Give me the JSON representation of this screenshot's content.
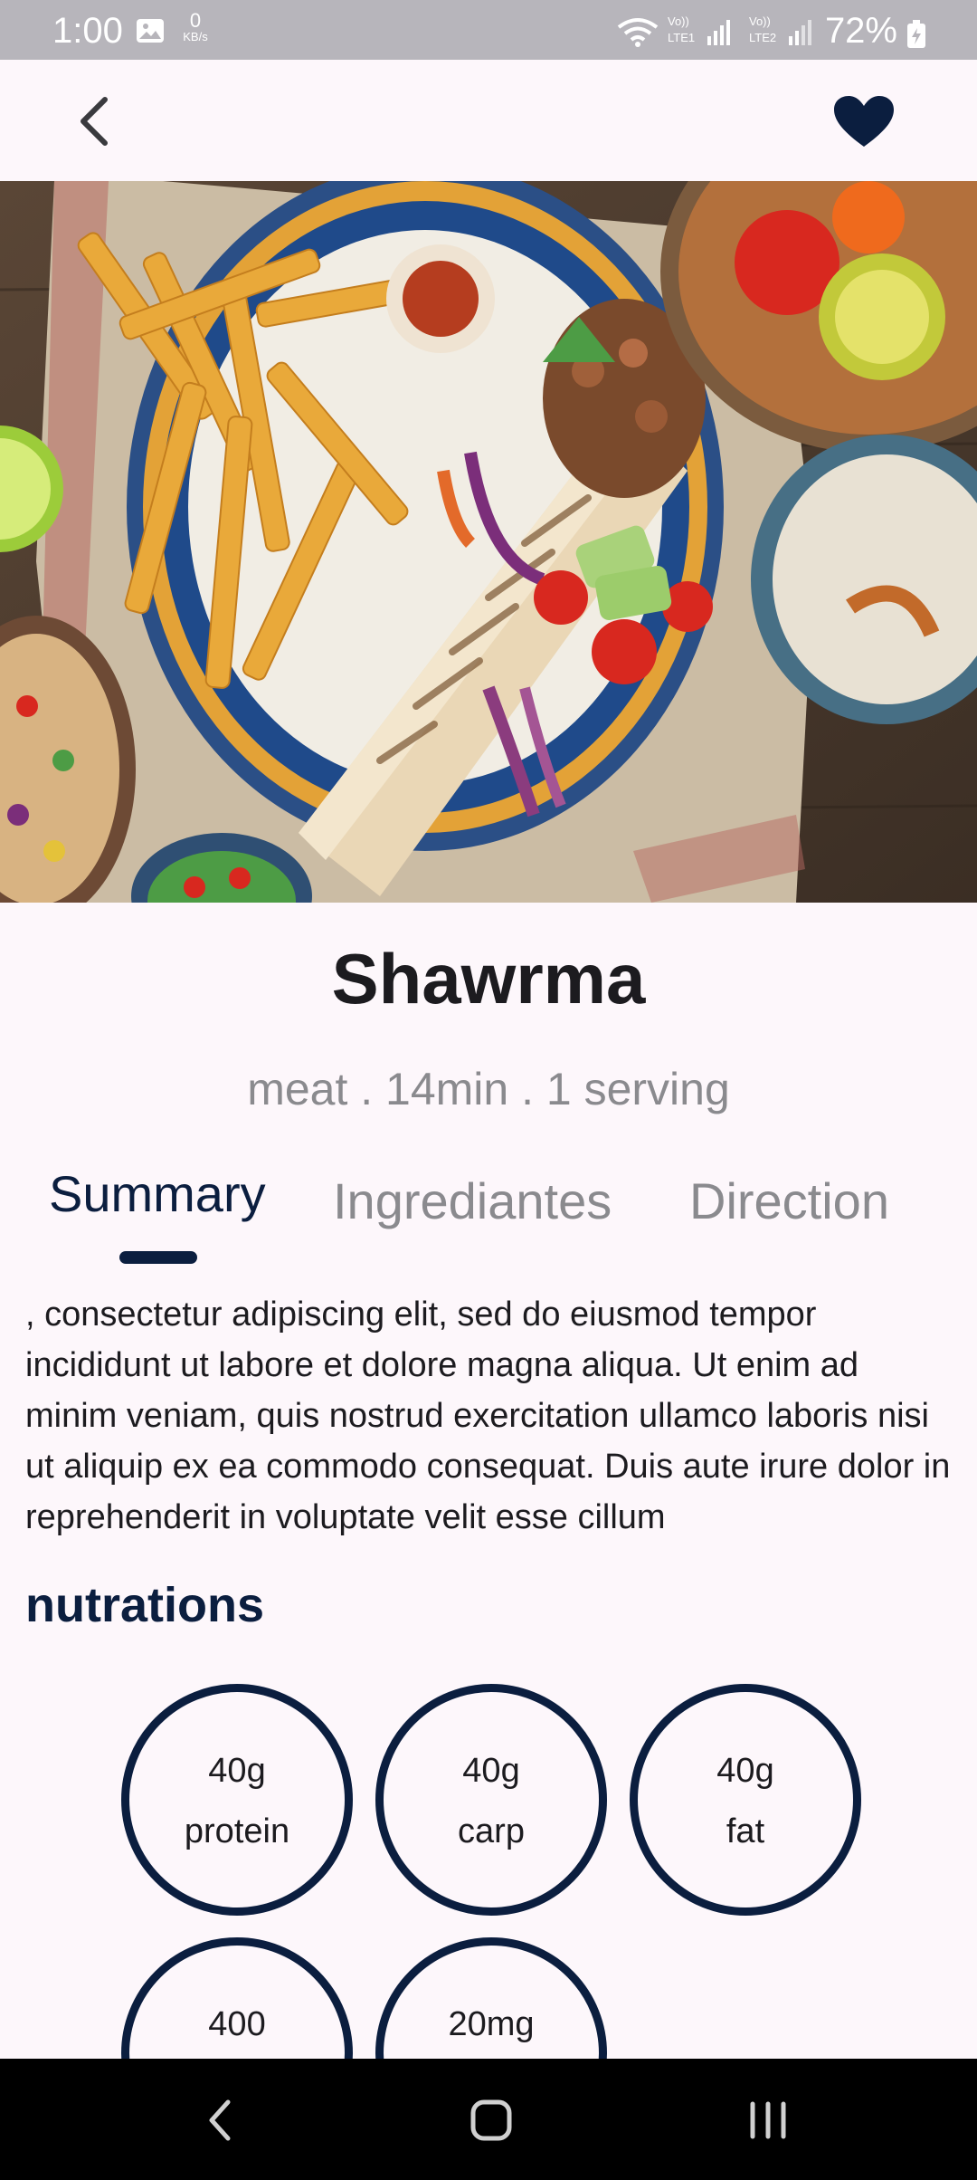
{
  "status_bar": {
    "time": "1:00",
    "net_speed_value": "0",
    "net_speed_unit": "KB/s",
    "battery": "72%",
    "icons": [
      "image-icon",
      "wifi-icon",
      "volte-lte1-signal-icon",
      "volte-lte2-signal-icon",
      "battery-charging-icon"
    ]
  },
  "app_bar": {
    "back_icon": "chevron-left-icon",
    "favorite_icon": "heart-filled-icon"
  },
  "recipe": {
    "title": "Shawrma",
    "meta": "meat . 14min . 1 serving"
  },
  "tabs": [
    {
      "label": "Summary",
      "active": true
    },
    {
      "label": "Ingrediantes",
      "active": false
    },
    {
      "label": "Direction",
      "active": false
    }
  ],
  "summary": {
    "text": ", consectetur adipiscing elit, sed do eiusmod tempor incididunt ut labore et dolore magna aliqua. Ut enim ad minim veniam, quis nostrud exercitation ullamco laboris nisi ut aliquip ex ea commodo consequat. Duis aute irure dolor in reprehenderit in voluptate velit esse cillum"
  },
  "nutrition": {
    "heading": "nutrations",
    "items": [
      {
        "amount": "40g",
        "label": "protein"
      },
      {
        "amount": "40g",
        "label": "carp"
      },
      {
        "amount": "40g",
        "label": "fat"
      },
      {
        "amount": "400",
        "label": ""
      },
      {
        "amount": "20mg",
        "label": ""
      }
    ]
  },
  "colors": {
    "accent": "#0b1e3f",
    "background": "#fdf7fb",
    "muted_text": "#8a8a8e",
    "status_bar": "#b7b5bb"
  }
}
